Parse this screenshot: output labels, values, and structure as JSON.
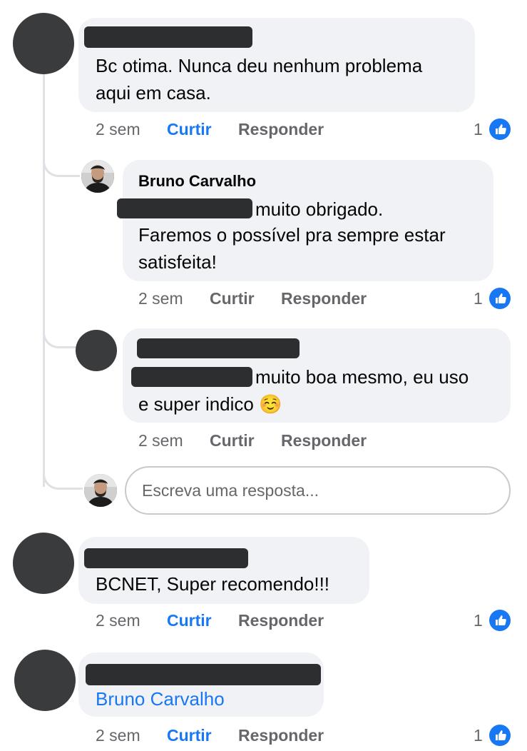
{
  "comments": [
    {
      "text": "Bc otima. Nunca deu nenhum problema aqui em casa.",
      "text_line1": "Bc otima. Nunca deu nenhum problema",
      "text_line2": "aqui em casa.",
      "time": "2 sem",
      "like_label": "Curtir",
      "reply_label": "Responder",
      "reactions": "1"
    },
    {
      "text": "BCNET, Super recomendo!!!",
      "time": "2 sem",
      "like_label": "Curtir",
      "reply_label": "Responder",
      "reactions": "1"
    },
    {
      "mention": "Bruno Carvalho",
      "time": "2 sem",
      "like_label": "Curtir",
      "reply_label": "Responder",
      "reactions": "1"
    }
  ],
  "replies": [
    {
      "author": "Bruno Carvalho",
      "text_line1": "muito obrigado.",
      "text_line2": "Faremos o possível pra sempre estar",
      "text_line3": "satisfeita!",
      "time": "2 sem",
      "like_label": "Curtir",
      "reply_label": "Responder",
      "reactions": "1"
    },
    {
      "text_line1": "muito boa mesmo, eu uso",
      "text_line2": "e super indico",
      "emoji": "☺️",
      "time": "2 sem",
      "like_label": "Curtir",
      "reply_label": "Responder"
    }
  ],
  "reply_input": {
    "placeholder": "Escreva uma resposta..."
  },
  "colors": {
    "accent": "#1877f2",
    "bubble": "#f0f2f5",
    "meta": "#65676b"
  },
  "icons": {
    "like": "thumbs-up-icon"
  }
}
